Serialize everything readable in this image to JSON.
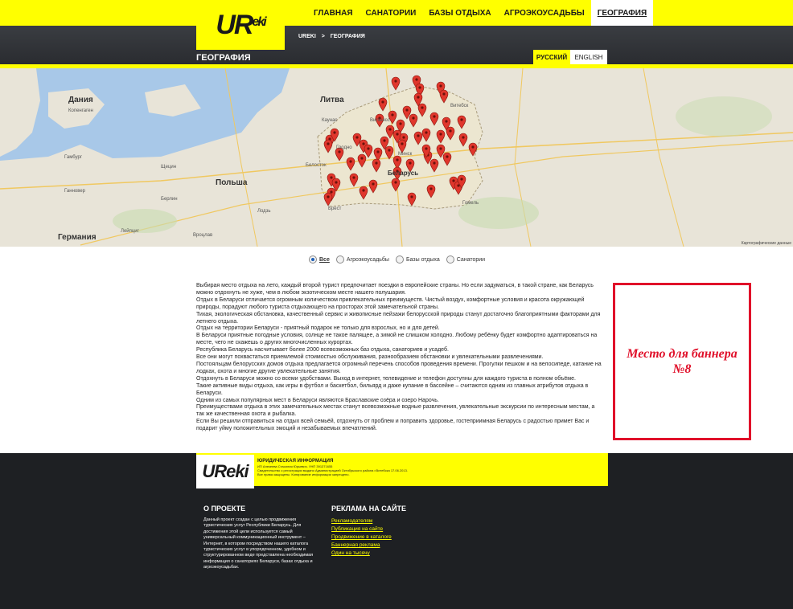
{
  "header": {
    "logo_text": "UR",
    "logo_sup": "eki",
    "nav": [
      "ГЛАВНАЯ",
      "САНАТОРИИ",
      "БАЗЫ ОТДЫХА",
      "АГРОЭКОУСАДЬБЫ",
      "ГЕОГРАФИЯ"
    ],
    "active_nav": "ГЕОГРАФИЯ",
    "breadcrumb": [
      "UREKI",
      ">",
      "ГЕОГРАФИЯ"
    ],
    "page_title": "ГЕОГРАФИЯ",
    "lang_ru": "РУССКИЙ",
    "lang_en": "ENGLISH",
    "accent_color": "#ffff00"
  },
  "map": {
    "labels": [
      "Дания",
      "Литва",
      "Польша",
      "Германия",
      "Беларусь"
    ],
    "small_labels": [
      "Копенгаген",
      "Гамбург",
      "Щецин",
      "Берлин",
      "Ганновер",
      "Лейпциг",
      "Вроцлав",
      "Лодзь",
      "Белосток",
      "Гродно",
      "Брест",
      "Минск",
      "Витебск",
      "Гомель",
      "Вильнюс",
      "Каунас"
    ],
    "marker_color": "#e0362c",
    "attribution": "Картографические данные"
  },
  "filters": {
    "options": [
      "Все",
      "Агроэкоусадьбы",
      "Базы отдыха",
      "Санатории"
    ],
    "selected": "Все"
  },
  "content": {
    "paragraphs": [
      "Выбирая место отдыха на лето, каждый второй турист предпочитает поездки в европейские страны. Но если задуматься, в такой стране, как Беларусь можно отдохнуть не хуже, чем в любом экзотическом месте нашего полушария.",
      "Отдых в Беларуси отличается огромным количеством привлекательных преимуществ. Чистый воздух, комфортные условия и красота окружающей природы, порадуют любого туриста отдыхающего на просторах этой замечательной страны.",
      "Тихая, экологическая обстановка, качественный сервис и живописные пейзажи белорусской природы станут достаточно благоприятными факторами для летнего отдыха.",
      "Отдых на территории Беларуси - приятный подарок не только для взрослых, но и для детей.",
      "В Беларуси приятные погодные условия, солнце не такое палящее, а зимой не слишком холодно. Любому ребёнку будет комфортно адаптироваться на месте, чего не скажешь о других многочисленных курортах.",
      "Республика Беларусь насчитывает более 2000 всевозможных баз отдыха, санаториев и усадеб.",
      "Все они могут похвастаться приемлемой стоимостью обслуживания, разнообразием обстановки и увлекательными развлечениями.",
      "Постояльцам белорусских домов отдыха предлагается огромный перечень способов проведения времени. Прогулки пешком и на велосипеде, катание на лодках, охота и многие другие увлекательные занятия.",
      "Отдохнуть в Беларуси можно со всеми удобствами. Выход в интернет, телевидение и телефон доступны для каждого туриста в полном объёме.",
      "Такие активные виды отдыха, как игры в футбол и баскетбол, бильярд и даже купание в бассейне – считаются одним из главных атрибутов отдыха в Беларуси.",
      "Одним из самых популярных мест в Беларуси являются Браславские озёра и озеро Нарочь.",
      "Преимуществами отдыха в этих замечательных местах станут всевозможные водные развлечения, увлекательные экскурсии по интересным местам, а так же качественная охота и рыбалка.",
      "Если Вы решили отправиться на отдых всей семьёй, отдохнуть от проблем и поправить здоровье, гостеприимная Беларусь с радостью примет Вас и подарит уйму положительных эмоций и незабываемых впечатлений."
    ]
  },
  "banner": {
    "line1": "Место для баннера",
    "line2": "№8",
    "border_color": "#e0102a"
  },
  "footer": {
    "logo_text": "UReki",
    "legal_title": "ЮРИДИЧЕСКАЯ ИНФОРМАЦИЯ",
    "legal_lines": [
      "ИП Алекеева Стасилия Юрьевич. УНП 391371655",
      "Свидетельство о регистрации выдано Администрацией Октябрьского района г.Витебска 17.06.2013.",
      "Все права защищены. Копирование информации запрещено."
    ],
    "about_title": "О ПРОЕКТЕ",
    "about_text": "Данный проект создан с целью продвижения туристических услуг Республики Беларусь. Для достижения этой цели используется самый универсальный коммуникационный инструмент – Интернет, в котором посредством нашего каталога туристических услуг в упорядоченном, удобном и структурированном виде представлена необходимая информация о санаториях Беларуси, базах отдыха и агроэкоусадьбах.",
    "ads_title": "РЕКЛАМА НА САЙТЕ",
    "ads_links": [
      "Рекламодателям",
      "Публикация на сайте",
      "Продвижение в каталоге",
      "Баннерная реклама",
      "Один на тысячу"
    ]
  }
}
